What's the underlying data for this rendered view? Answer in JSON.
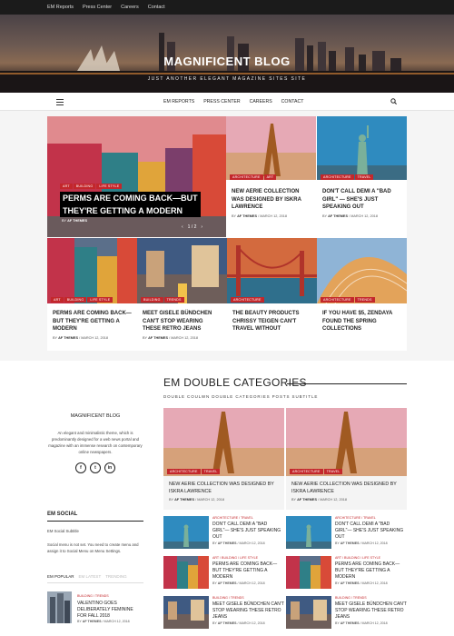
{
  "topbar": {
    "links": [
      "EM Reports",
      "Press Center",
      "Careers",
      "Contact"
    ]
  },
  "header": {
    "title": "MAGNIFICENT BLOG",
    "tagline": "JUST ANOTHER ELEGANT MAGAZINE SITES SITE"
  },
  "nav": {
    "items": [
      "EM REPORTS",
      "PRESS CENTER",
      "CAREERS",
      "CONTACT"
    ]
  },
  "featured": {
    "categories": [
      "ART",
      "BUILDING",
      "LIFE STYLE"
    ],
    "title_line1": "PERMS ARE COMING BACK—BUT",
    "title_line2": "THEY'RE GETTING A MODERN",
    "meta_by": "BY",
    "meta_author": "AF THEMES",
    "pager": "1 / 2",
    "prev": "‹",
    "next": "›"
  },
  "grid": [
    {
      "cats": [
        "ARCHITECTURE",
        "ART"
      ],
      "title": "NEW AERIE COLLECTION WAS DESIGNED BY ISKRA LAWRENCE",
      "author": "AF THEMES",
      "date": "MARCH 12, 2018"
    },
    {
      "cats": [
        "ARCHITECTURE",
        "TRAVEL"
      ],
      "title": "DON'T CALL DEMI A \"BAD GIRL\" — SHE'S JUST SPEAKING OUT",
      "author": "AF THEMES",
      "date": "MARCH 12, 2018"
    },
    {
      "cats": [
        "ART",
        "BUILDING",
        "LIFE STYLE"
      ],
      "title": "PERMS ARE COMING BACK—BUT THEY'RE GETTING A MODERN",
      "author": "AF THEMES",
      "date": "MARCH 12, 2018"
    },
    {
      "cats": [
        "BUILDING",
        "TRENDS"
      ],
      "title": "MEET GISELE BÜNDCHEN CAN'T STOP WEARING THESE RETRO JEANS",
      "author": "AF THEMES",
      "date": "MARCH 12, 2018"
    },
    {
      "cats": [
        "ARCHITECTURE"
      ],
      "title": "THE BEAUTY PRODUCTS CHRISSY TEIGEN CAN'T TRAVEL WITHOUT",
      "author": "AF THEMES",
      "date": "MARCH 12, 2018"
    },
    {
      "cats": [
        "ARCHITECTURE",
        "TRENDS"
      ],
      "title": "IF YOU HAVE $5, ZENDAYA FOUND THE SPRING COLLECTIONS",
      "author": "AF THEMES",
      "date": "MARCH 12, 2018"
    }
  ],
  "sidebar": {
    "title": "MAGNIFICENT BLOG",
    "description": "An elegant and minimalistic theme, which is predominantly designed for a web news portal and magazine with an immense research on contemporary online newspapers.",
    "social": [
      "f",
      "t",
      "in"
    ],
    "em_social_title": "EM SOCIAL",
    "em_social_subtitle": "EM Social Subtitle",
    "em_social_desc": "Social menu is not set. You need to create menu and assign it to Social Menu on Menu Settings.",
    "tabs": [
      "EM POPULAR",
      "EM LATEST",
      "TRENDING"
    ],
    "popular": {
      "cats": "BUILDING / TRENDS",
      "title": "VALENTINO GOES DELIBERATELY FEMININE FOR FALL 2018",
      "author": "AF THEMES",
      "date": "MARCH 12, 2018"
    }
  },
  "double": {
    "title": "EM DOUBLE CATEGORIES",
    "subtitle": "DOUBLE COULWN DOUBLE CATEGORIES POSTS SUBTITLE",
    "cards": [
      {
        "cats": [
          "ARCHITECTURE",
          "TRAVEL"
        ],
        "title": "NEW AERIE COLLECTION WAS DESIGNED BY ISKRA LAWRENCE",
        "author": "AF THEMES",
        "date": "MARCH 12, 2018"
      },
      {
        "cats": [
          "ARCHITECTURE",
          "TRAVEL"
        ],
        "title": "NEW AERIE COLLECTION WAS DESIGNED BY ISKRA LAWRENCE",
        "author": "AF THEMES",
        "date": "MARCH 12, 2018"
      }
    ],
    "left_rows": [
      {
        "cats": "ARCHITECTURE / TRAVEL",
        "title": "DON'T CALL DEMI A \"BAD GIRL\"— SHE'S JUST SPEAKING OUT",
        "author": "AF THEMES",
        "date": "MARCH 12, 2018"
      },
      {
        "cats": "ART / BUILDING / LIFE STYLE",
        "title": "PERMS ARE COMING BACK—BUT THEY'RE GETTING A MODERN",
        "author": "AF THEMES",
        "date": "MARCH 12, 2018"
      },
      {
        "cats": "BUILDING / TRENDS",
        "title": "MEET GISELE BÜNDCHEN CAN'T STOP WEARING THESE RETRO JEANS",
        "author": "AF THEMES",
        "date": "MARCH 12, 2018"
      }
    ],
    "right_rows": [
      {
        "cats": "ARCHITECTURE / TRAVEL",
        "title": "DON'T CALL DEMI A \"BAD GIRL\"— SHE'S JUST SPEAKING OUT",
        "author": "AF THEMES",
        "date": "MARCH 12, 2018"
      },
      {
        "cats": "ART / BUILDING / LIFE STYLE",
        "title": "PERMS ARE COMING BACK—BUT THEY'RE GETTING A MODERN",
        "author": "AF THEMES",
        "date": "MARCH 12, 2018"
      },
      {
        "cats": "BUILDING / TRENDS",
        "title": "MEET GISELE BÜNDCHEN CAN'T STOP WEARING THESE RETRO JEANS",
        "author": "AF THEMES",
        "date": "MARCH 12, 2018"
      }
    ]
  },
  "colors": {
    "accent": "#c3272b",
    "topbar": "#1b1b1b"
  }
}
